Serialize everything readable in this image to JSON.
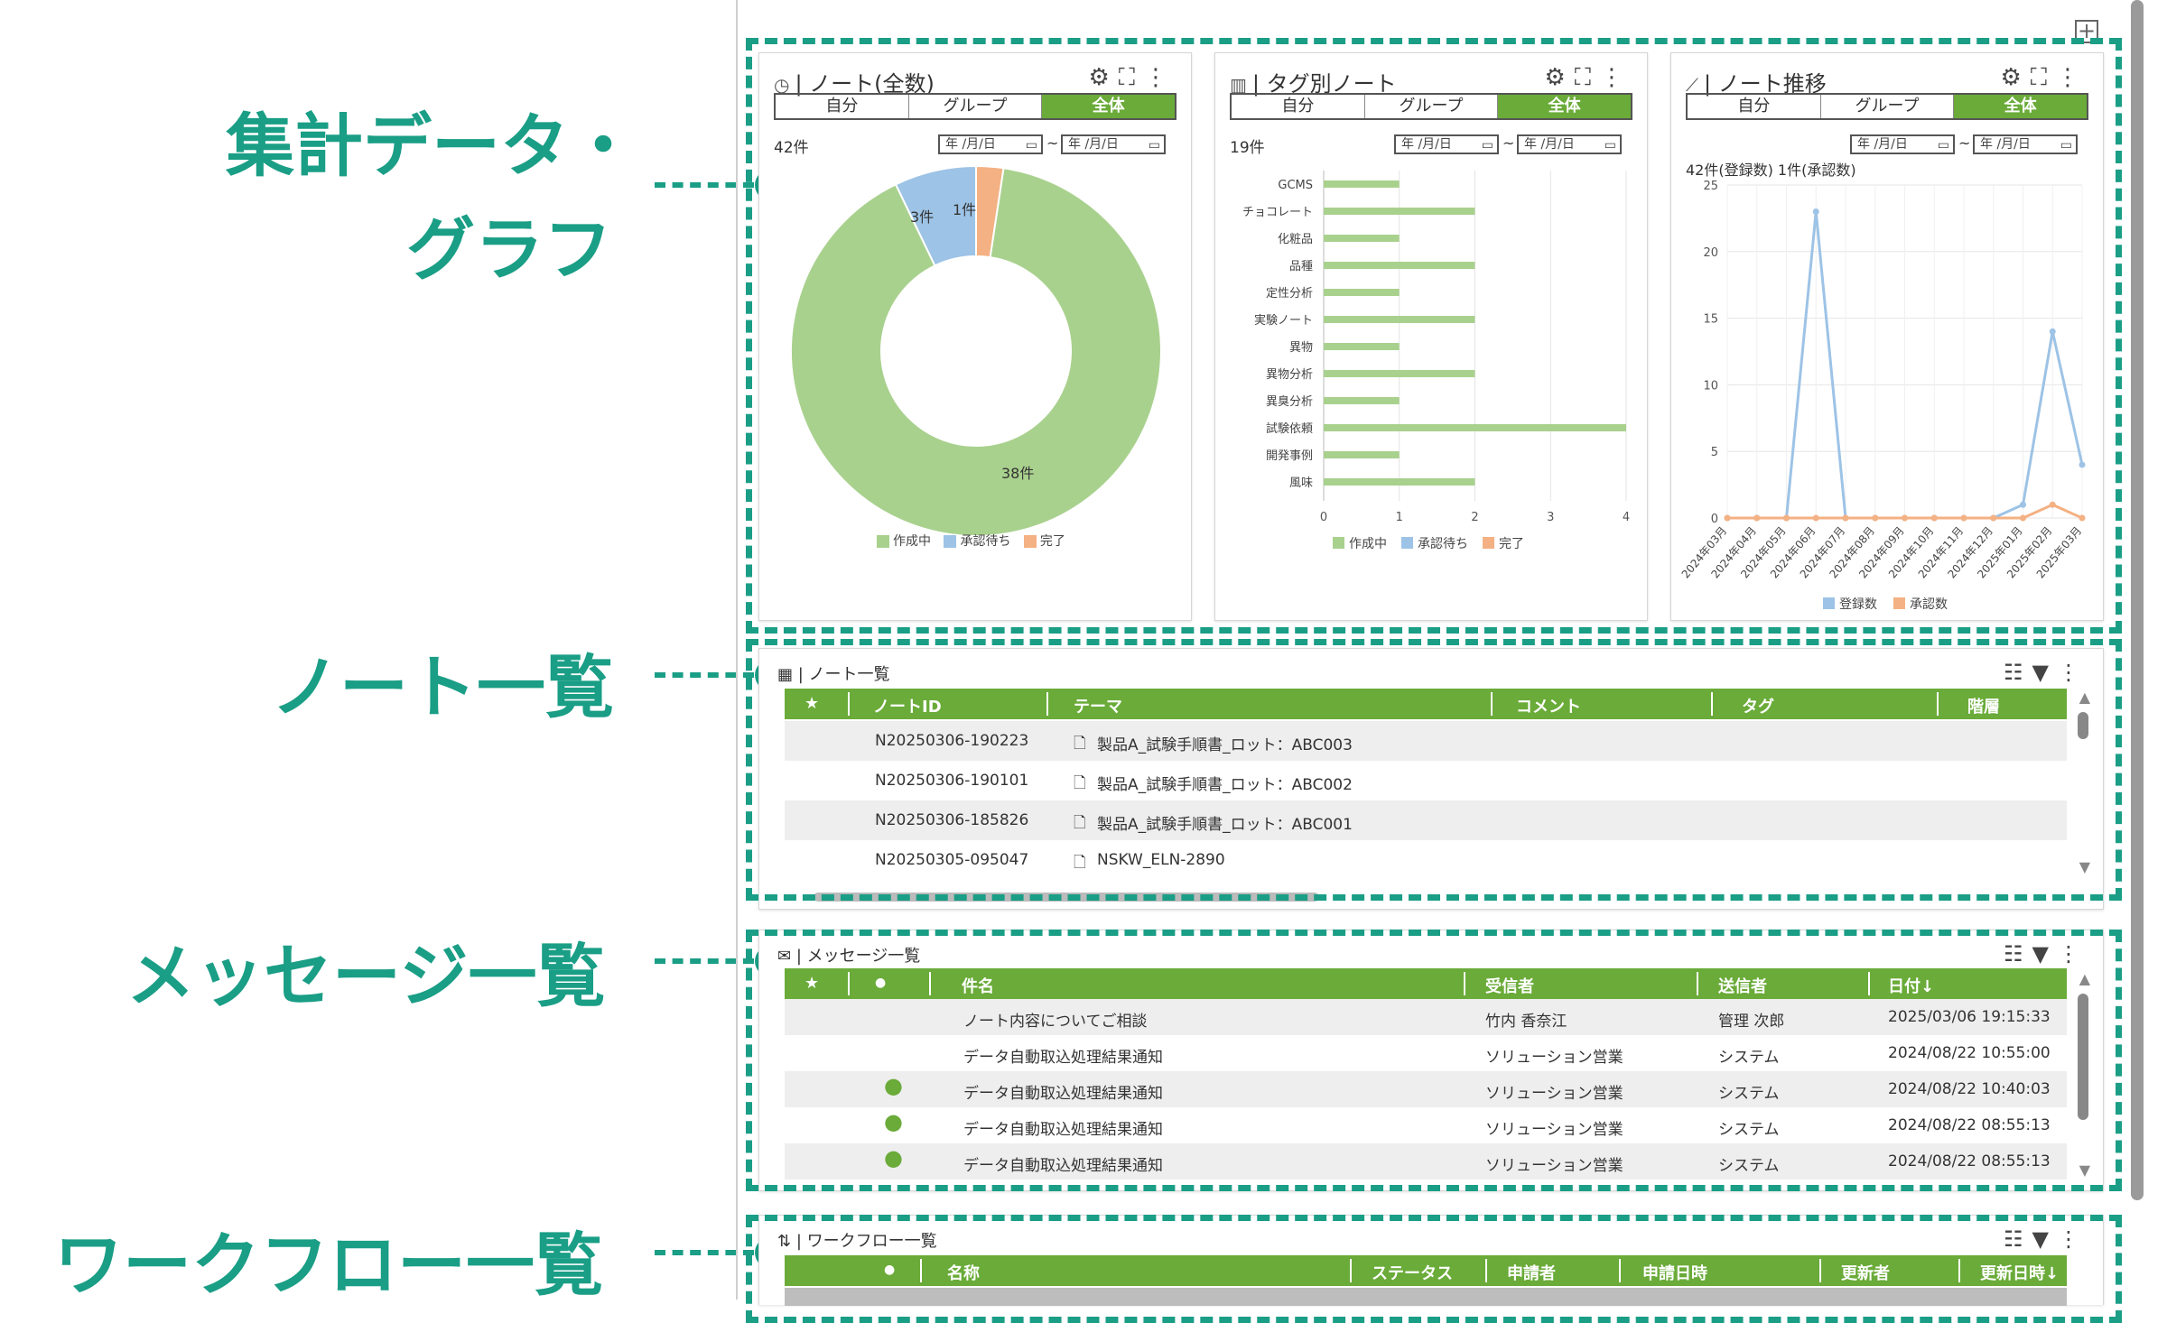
{
  "annotations": {
    "summary_line1": "集計データ・",
    "summary_line2": "グラフ",
    "note_list": "ノート一覧",
    "message_list": "メッセージ一覧",
    "workflow_list": "ワークフロー一覧"
  },
  "colors": {
    "accent": "#1a9e86",
    "header_green": "#6aab39",
    "active_tab": "#6aab39"
  },
  "segments": [
    "自分",
    "グループ",
    "全体"
  ],
  "date_placeholder": "年 /月/日",
  "panel_notes_total": {
    "title": "ノート(全数)",
    "count": "42件",
    "labels": {
      "s1": "3件",
      "s2": "1件",
      "s3": "38件"
    },
    "legend": [
      "作成中",
      "承認待ち",
      "完了"
    ]
  },
  "panel_tag_notes": {
    "title": "タグ別ノート",
    "count": "19件",
    "legend": [
      "作成中",
      "承認待ち",
      "完了"
    ]
  },
  "panel_note_trend": {
    "title": "ノート推移",
    "summary": "42件(登録数) 1件(承認数)",
    "legend": [
      "登録数",
      "承認数"
    ]
  },
  "note_list": {
    "title": "ノート一覧",
    "columns": [
      "★",
      "ノートID",
      "テーマ",
      "コメント",
      "タグ",
      "階層"
    ],
    "rows": [
      {
        "id": "N20250306-190223",
        "theme": "製品A_試験手順書_ロット：ABC003"
      },
      {
        "id": "N20250306-190101",
        "theme": "製品A_試験手順書_ロット：ABC002"
      },
      {
        "id": "N20250306-185826",
        "theme": "製品A_試験手順書_ロット：ABC001"
      },
      {
        "id": "N20250305-095047",
        "theme": "NSKW_ELN-2890"
      }
    ]
  },
  "message_list": {
    "title": "メッセージ一覧",
    "columns": [
      "★",
      "●",
      "件名",
      "受信者",
      "送信者",
      "日付↓"
    ],
    "rows": [
      {
        "unread": "",
        "subject": "ノート内容についてご相談",
        "to": "竹内 香奈江",
        "from": "管理 次郎",
        "date": "2025/03/06 19:15:33"
      },
      {
        "unread": "",
        "subject": "データ自動取込処理結果通知",
        "to": "ソリューション営業",
        "from": "システム",
        "date": "2024/08/22 10:55:00"
      },
      {
        "unread": "●",
        "subject": "データ自動取込処理結果通知",
        "to": "ソリューション営業",
        "from": "システム",
        "date": "2024/08/22 10:40:03"
      },
      {
        "unread": "●",
        "subject": "データ自動取込処理結果通知",
        "to": "ソリューション営業",
        "from": "システム",
        "date": "2024/08/22 08:55:13"
      },
      {
        "unread": "●",
        "subject": "データ自動取込処理結果通知",
        "to": "ソリューション営業",
        "from": "システム",
        "date": "2024/08/22 08:55:13"
      }
    ]
  },
  "workflow_list": {
    "title": "ワークフロー一覧",
    "columns": [
      "●",
      "名称",
      "ステータス",
      "申請者",
      "申請日時",
      "更新者",
      "更新日時↓"
    ]
  },
  "chart_data": [
    {
      "type": "pie",
      "categories": [
        "作成中",
        "承認待ち",
        "完了"
      ],
      "values": [
        38,
        3,
        1
      ],
      "colors": [
        "#a9d18e",
        "#9dc3e6",
        "#f4b183"
      ],
      "legend_position": "bottom"
    },
    {
      "type": "bar",
      "orientation": "horizontal",
      "categories": [
        "GCMS",
        "チョコレート",
        "化粧品",
        "品種",
        "定性分析",
        "実験ノート",
        "異物",
        "異物分析",
        "異臭分析",
        "試験依頼",
        "開発事例",
        "風味"
      ],
      "series": [
        {
          "name": "作成中",
          "values": [
            1,
            2,
            1,
            2,
            1,
            2,
            1,
            2,
            1,
            4,
            1,
            2
          ]
        }
      ],
      "xlim": [
        0,
        4
      ],
      "xticks": [
        "0",
        "1",
        "2",
        "3",
        "4"
      ],
      "legend": [
        "作成中",
        "承認待ち",
        "完了"
      ],
      "grid": true
    },
    {
      "type": "line",
      "categories": [
        "2024年03月",
        "2024年04月",
        "2024年05月",
        "2024年06月",
        "2024年07月",
        "2024年08月",
        "2024年09月",
        "2024年10月",
        "2024年11月",
        "2024年12月",
        "2025年01月",
        "2025年02月",
        "2025年03月"
      ],
      "series": [
        {
          "name": "登録数",
          "color": "#9dc3e6",
          "values": [
            0,
            0,
            0,
            23,
            0,
            0,
            0,
            0,
            0,
            0,
            1,
            14,
            4
          ]
        },
        {
          "name": "承認数",
          "color": "#f4b183",
          "values": [
            0,
            0,
            0,
            0,
            0,
            0,
            0,
            0,
            0,
            0,
            0,
            1,
            0
          ]
        }
      ],
      "ylim": [
        0,
        25
      ],
      "yticks": [
        "0",
        "5",
        "10",
        "15",
        "20",
        "25"
      ],
      "grid": true
    }
  ]
}
